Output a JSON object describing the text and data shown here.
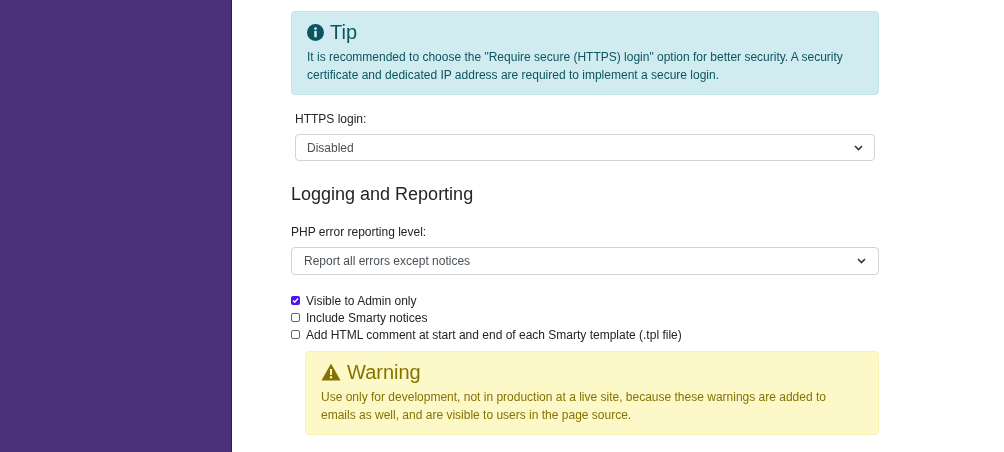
{
  "tip": {
    "title": "Tip",
    "text": "It is recommended to choose the \"Require secure (HTTPS) login\" option for better security. A security certificate and dedicated IP address are required to implement a secure login."
  },
  "https_login": {
    "label": "HTTPS login:",
    "value": "Disabled"
  },
  "section_title": "Logging and Reporting",
  "error_level": {
    "label": "PHP error reporting level:",
    "value": "Report all errors except notices"
  },
  "options": [
    {
      "label": "Visible to Admin only",
      "checked": true
    },
    {
      "label": "Include Smarty notices",
      "checked": false
    },
    {
      "label": "Add HTML comment at start and end of each Smarty template (.tpl file)",
      "checked": false
    }
  ],
  "warning": {
    "title": "Warning",
    "text": "Use only for development, not in production at a live site, because these warnings are added to emails as well, and are visible to users in the page source."
  }
}
